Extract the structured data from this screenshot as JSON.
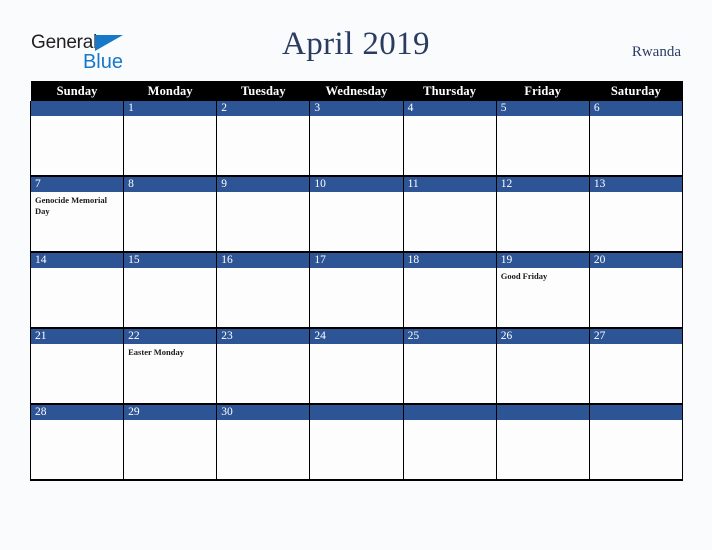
{
  "brand": {
    "name_part1": "General",
    "name_part2": "Blue",
    "triangle_color": "#1878c8",
    "text_color": "#231f20"
  },
  "header": {
    "title": "April 2019",
    "country": "Rwanda",
    "title_color": "#2b3c61"
  },
  "calendar": {
    "month": "April",
    "year": "2019",
    "accent_color": "#2d5495",
    "header_bg": "#000000",
    "weekday_headers": [
      "Sunday",
      "Monday",
      "Tuesday",
      "Wednesday",
      "Thursday",
      "Friday",
      "Saturday"
    ],
    "weeks": [
      [
        {
          "day": "",
          "events": []
        },
        {
          "day": "1",
          "events": []
        },
        {
          "day": "2",
          "events": []
        },
        {
          "day": "3",
          "events": []
        },
        {
          "day": "4",
          "events": []
        },
        {
          "day": "5",
          "events": []
        },
        {
          "day": "6",
          "events": []
        }
      ],
      [
        {
          "day": "7",
          "events": [
            "Genocide Memorial Day"
          ]
        },
        {
          "day": "8",
          "events": []
        },
        {
          "day": "9",
          "events": []
        },
        {
          "day": "10",
          "events": []
        },
        {
          "day": "11",
          "events": []
        },
        {
          "day": "12",
          "events": []
        },
        {
          "day": "13",
          "events": []
        }
      ],
      [
        {
          "day": "14",
          "events": []
        },
        {
          "day": "15",
          "events": []
        },
        {
          "day": "16",
          "events": []
        },
        {
          "day": "17",
          "events": []
        },
        {
          "day": "18",
          "events": []
        },
        {
          "day": "19",
          "events": [
            "Good Friday"
          ]
        },
        {
          "day": "20",
          "events": []
        }
      ],
      [
        {
          "day": "21",
          "events": []
        },
        {
          "day": "22",
          "events": [
            "Easter Monday"
          ]
        },
        {
          "day": "23",
          "events": []
        },
        {
          "day": "24",
          "events": []
        },
        {
          "day": "25",
          "events": []
        },
        {
          "day": "26",
          "events": []
        },
        {
          "day": "27",
          "events": []
        }
      ],
      [
        {
          "day": "28",
          "events": []
        },
        {
          "day": "29",
          "events": []
        },
        {
          "day": "30",
          "events": []
        },
        {
          "day": "",
          "events": []
        },
        {
          "day": "",
          "events": []
        },
        {
          "day": "",
          "events": []
        },
        {
          "day": "",
          "events": []
        }
      ]
    ]
  }
}
